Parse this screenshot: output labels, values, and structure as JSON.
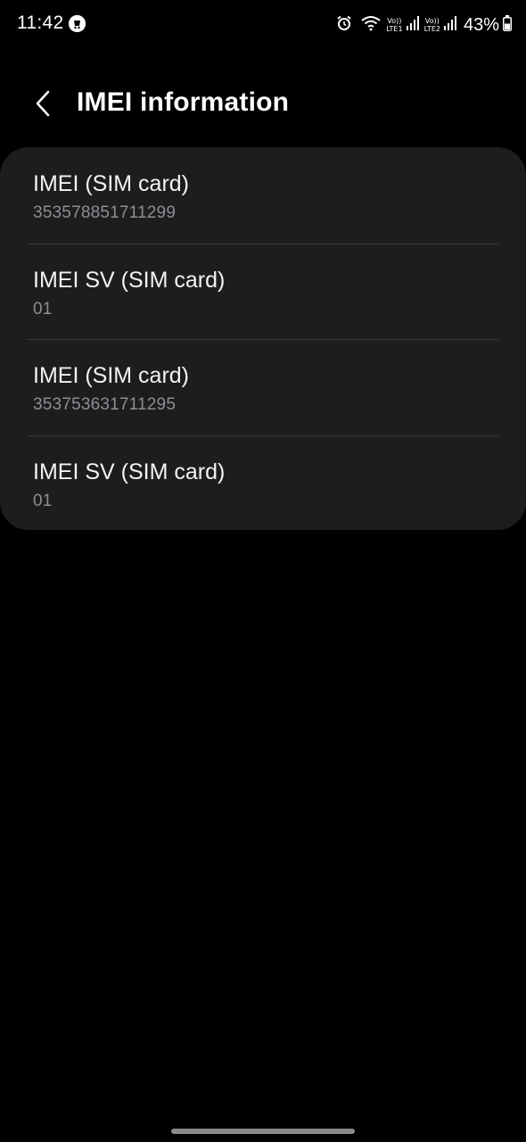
{
  "status_bar": {
    "time": "11:42",
    "battery_percent": "43%",
    "sim1_label_top": "Vo))",
    "sim1_label_bottom": "LTE1",
    "sim2_label_top": "Vo))",
    "sim2_label_bottom": "LTE2",
    "battery_level": 0.43,
    "icons": [
      "app-notification-icon",
      "alarm-icon",
      "wifi-icon",
      "signal-icon",
      "battery-icon"
    ]
  },
  "header": {
    "title": "IMEI information",
    "back_icon": "chevron-left-icon"
  },
  "items": [
    {
      "label": "IMEI (SIM card)",
      "value": "353578851711299"
    },
    {
      "label": "IMEI SV (SIM card)",
      "value": "01"
    },
    {
      "label": "IMEI (SIM card)",
      "value": "353753631711295"
    },
    {
      "label": "IMEI SV (SIM card)",
      "value": "01"
    }
  ],
  "colors": {
    "background": "#000000",
    "card": "#1d1d1f",
    "primary_text": "#f2f2f2",
    "secondary_text": "#8e8e93",
    "divider": "#3a3a3c"
  }
}
